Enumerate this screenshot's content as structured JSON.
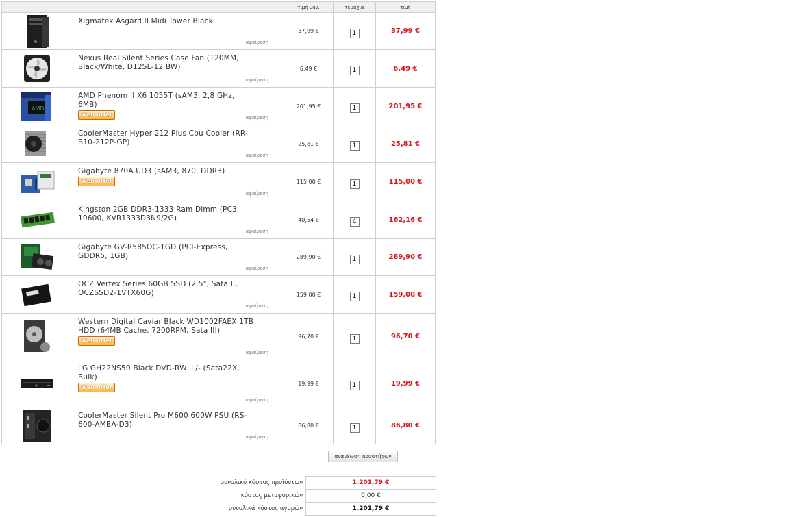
{
  "header": {
    "unit_price": "τιμή μον.",
    "quantity": "τεμάχια",
    "price": "τιμή"
  },
  "remove_label": "αφαίρεση",
  "web_offer_label": "Web offer",
  "items": [
    {
      "name": "Xigmatek Asgard II Midi Tower Black",
      "unit_price": "37,99 €",
      "qty": "1",
      "price": "37,99 €",
      "web_offer": false,
      "icon": "tower-case-icon"
    },
    {
      "name": "Nexus Real Silent Series Case Fan (120MM, Black/White, D12SL-12 BW)",
      "unit_price": "6,49 €",
      "qty": "1",
      "price": "6,49 €",
      "web_offer": false,
      "icon": "case-fan-icon"
    },
    {
      "name": "AMD Phenom II X6 1055T (sAM3, 2,8 GHz, 6MB)",
      "unit_price": "201,95 €",
      "qty": "1",
      "price": "201,95 €",
      "web_offer": true,
      "icon": "cpu-box-icon"
    },
    {
      "name": "CoolerMaster Hyper 212 Plus Cpu Cooler (RR-B10-212P-GP)",
      "unit_price": "25,81 €",
      "qty": "1",
      "price": "25,81 €",
      "web_offer": false,
      "icon": "cpu-cooler-icon"
    },
    {
      "name": "Gigabyte 870A UD3 (sAM3, 870, DDR3)",
      "unit_price": "115,00 €",
      "qty": "1",
      "price": "115,00 €",
      "web_offer": true,
      "icon": "motherboard-icon"
    },
    {
      "name": "Kingston 2GB DDR3-1333 Ram Dimm (PC3 10600, KVR1333D3N9/2G)",
      "unit_price": "40,54 €",
      "qty": "4",
      "price": "162,16 €",
      "web_offer": false,
      "icon": "ram-module-icon"
    },
    {
      "name": "Gigabyte GV-R585OC-1GD (PCI-Express, GDDR5, 1GB)",
      "unit_price": "289,90 €",
      "qty": "1",
      "price": "289,90 €",
      "web_offer": false,
      "icon": "graphics-card-icon"
    },
    {
      "name": "OCZ Vertex Series 60GB SSD (2.5\", Sata II, OCZSSD2-1VTX60G)",
      "unit_price": "159,00 €",
      "qty": "1",
      "price": "159,00 €",
      "web_offer": false,
      "icon": "ssd-icon"
    },
    {
      "name": "Western Digital Caviar Black WD1002FAEX 1TB HDD (64MB Cache, 7200RPM, Sata III)",
      "unit_price": "96,70 €",
      "qty": "1",
      "price": "96,70 €",
      "web_offer": true,
      "icon": "hard-drive-icon"
    },
    {
      "name": "LG GH22NS50 Black DVD-RW +/- (Sata22X, Bulk)",
      "unit_price": "19,99 €",
      "qty": "1",
      "price": "19,99 €",
      "web_offer": true,
      "icon": "dvd-drive-icon"
    },
    {
      "name": "CoolerMaster Silent Pro M600 600W PSU (RS-600-AMBA-D3)",
      "unit_price": "86,80 €",
      "qty": "1",
      "price": "86,80 €",
      "web_offer": false,
      "icon": "power-supply-icon"
    }
  ],
  "update_button": "ανανέωση ποσοτήτων",
  "totals": {
    "products_label": "συνολικό κόστος προϊόντων",
    "products_value": "1.201,79 €",
    "shipping_label": "κόστος μεταφορικών",
    "shipping_value": "0,00 €",
    "grand_label": "συνολικά κόστος αγορών",
    "grand_value": "1.201,79 €"
  },
  "colors": {
    "price_red": "#d3171b",
    "border": "#cfcfcf",
    "header_bg": "#efefef",
    "web_offer_orange": "#ffb640"
  }
}
